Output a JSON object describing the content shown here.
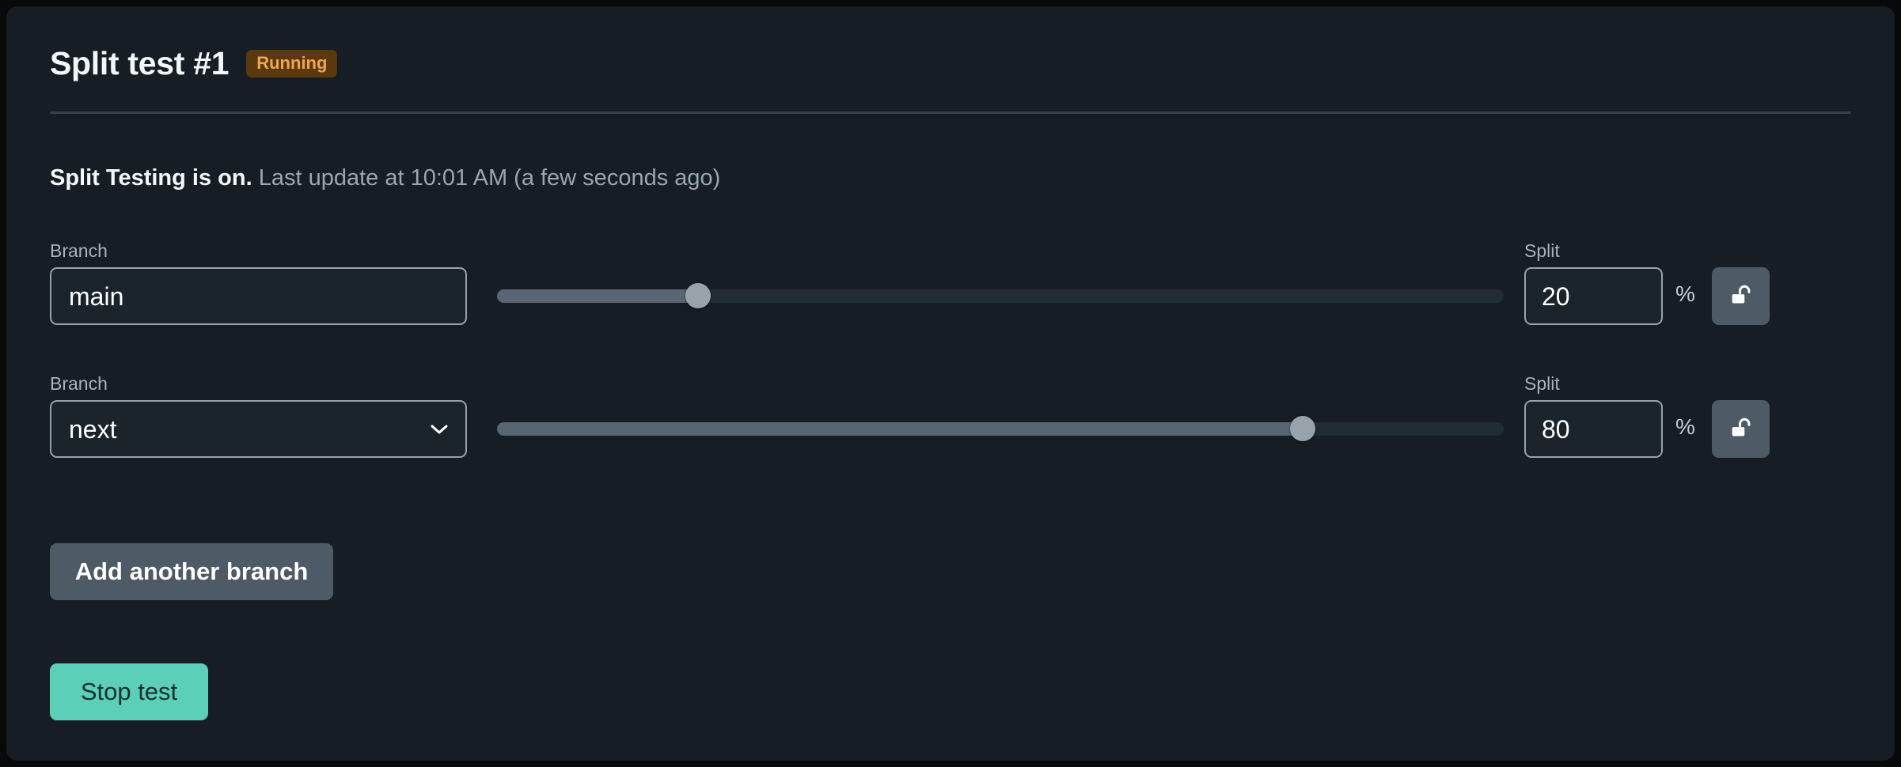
{
  "card": {
    "title": "Split test #1",
    "status_badge": "Running",
    "status_strong": "Split Testing is on.",
    "status_muted": "Last update at 10:01 AM (a few seconds ago)"
  },
  "labels": {
    "branch": "Branch",
    "split": "Split",
    "percent": "%"
  },
  "rows": [
    {
      "branch_label": "Branch",
      "branch_value": "main",
      "is_select": false,
      "split_label": "Split",
      "split_value": "20",
      "slider_percent": 20,
      "lock_icon": "unlock-icon",
      "lock_state": "unlocked"
    },
    {
      "branch_label": "Branch",
      "branch_value": "next",
      "is_select": true,
      "split_label": "Split",
      "split_value": "80",
      "slider_percent": 80,
      "lock_icon": "unlock-icon",
      "lock_state": "unlocked"
    }
  ],
  "buttons": {
    "add_branch": "Add another branch",
    "stop_test": "Stop test"
  },
  "colors": {
    "card_background": "#161d24",
    "page_background": "#07090b",
    "badge_background": "#5b390f",
    "badge_text": "#f0a552",
    "accent_teal": "#5ccfb8",
    "button_gray": "#4e5a65",
    "slider_fill": "#586672",
    "slider_track": "#222c35",
    "slider_thumb": "#98a2ab",
    "field_border": "#98a2ab",
    "muted_text": "#9aa6b0"
  }
}
